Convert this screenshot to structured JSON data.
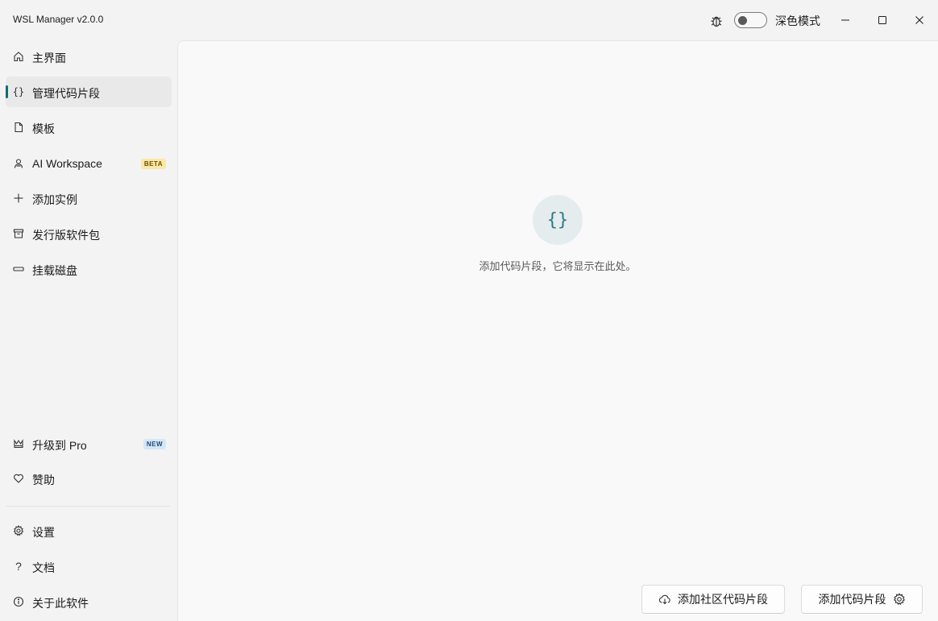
{
  "titlebar": {
    "app_title": "WSL Manager v2.0.0",
    "theme_label": "深色模式",
    "dark_mode_on": false
  },
  "sidebar": {
    "top_items": [
      {
        "label": "主界面",
        "icon": "home-icon",
        "selected": false
      },
      {
        "label": "管理代码片段",
        "icon": "braces-icon",
        "selected": true
      },
      {
        "label": "模板",
        "icon": "document-icon",
        "selected": false
      },
      {
        "label": "AI Workspace",
        "icon": "agent-icon",
        "selected": false,
        "badge": "BETA"
      },
      {
        "label": "添加实例",
        "icon": "plus-icon",
        "selected": false
      },
      {
        "label": "发行版软件包",
        "icon": "package-icon",
        "selected": false
      },
      {
        "label": "挂载磁盘",
        "icon": "disk-icon",
        "selected": false
      }
    ],
    "bottom_items": [
      {
        "label": "升级到 Pro",
        "icon": "crown-icon",
        "badge": "NEW"
      },
      {
        "label": "赞助",
        "icon": "heart-icon"
      }
    ],
    "footer_items": [
      {
        "label": "设置",
        "icon": "gear-icon"
      },
      {
        "label": "文档",
        "icon": "question-icon"
      },
      {
        "label": "关于此软件",
        "icon": "info-icon"
      }
    ]
  },
  "content": {
    "empty_icon_glyph": "{}",
    "empty_message": "添加代码片段，它将显示在此处。",
    "buttons": {
      "add_community": "添加社区代码片段",
      "add_snippet": "添加代码片段"
    }
  },
  "colors": {
    "accent": "#0f6b74",
    "badge_beta_bg": "#fbe7a8",
    "badge_new_bg": "#d4e6f7"
  }
}
